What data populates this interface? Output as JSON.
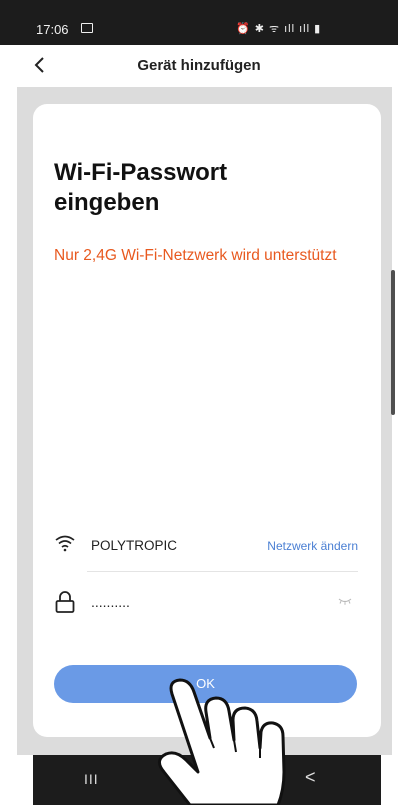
{
  "status_bar": {
    "time": "17:06",
    "icons": "⏰ ✱ ᯤ ıll ıll ▮"
  },
  "header": {
    "title": "Gerät hinzufügen"
  },
  "card": {
    "title": "Wi-Fi-Passwort eingeben",
    "warning": "Nur 2,4G Wi-Fi-Netzwerk wird unterstützt",
    "ssid": "POLYTROPIC",
    "change_network_label": "Netzwerk ändern",
    "password_value": "..........",
    "ok_label": "OK"
  },
  "nav": {
    "recent_label": "III",
    "back_label": "<"
  },
  "colors": {
    "accent": "#6a9ae6",
    "warning": "#e8591f",
    "link": "#4a7fd3"
  }
}
